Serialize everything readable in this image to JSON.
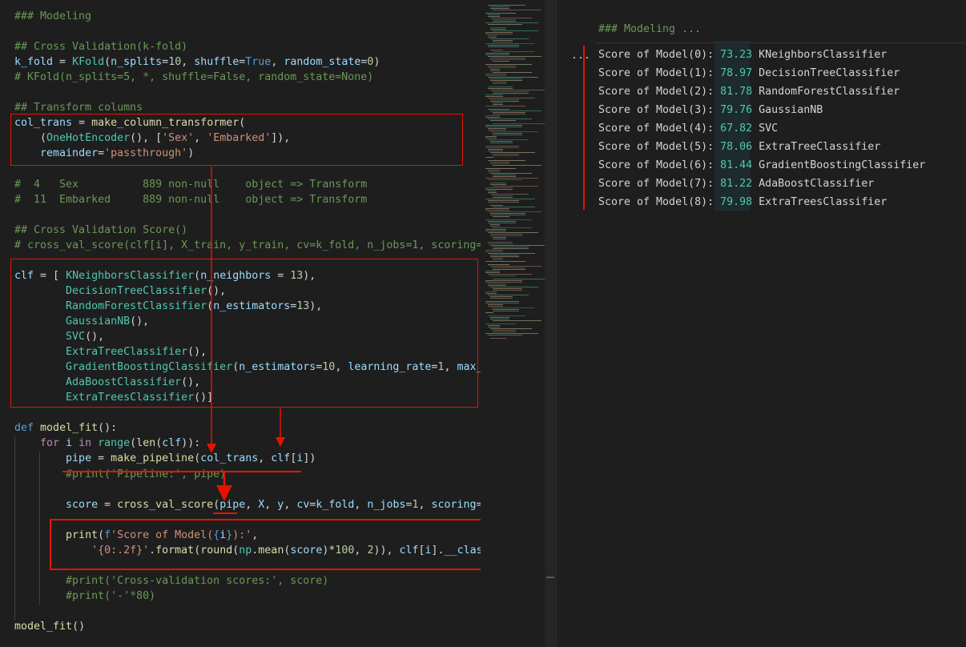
{
  "editor": {
    "lines": [
      [
        {
          "t": "### Modeling",
          "c": "comment"
        }
      ],
      [],
      [
        {
          "t": "## Cross Validation(k-fold)",
          "c": "comment"
        }
      ],
      [
        {
          "t": "k_fold",
          "c": "var"
        },
        {
          "t": " = ",
          "c": "plain"
        },
        {
          "t": "KFold",
          "c": "class"
        },
        {
          "t": "(",
          "c": "plain"
        },
        {
          "t": "n_splits",
          "c": "var"
        },
        {
          "t": "=",
          "c": "plain"
        },
        {
          "t": "10",
          "c": "num"
        },
        {
          "t": ", ",
          "c": "plain"
        },
        {
          "t": "shuffle",
          "c": "var"
        },
        {
          "t": "=",
          "c": "plain"
        },
        {
          "t": "True",
          "c": "kw"
        },
        {
          "t": ", ",
          "c": "plain"
        },
        {
          "t": "random_state",
          "c": "var"
        },
        {
          "t": "=",
          "c": "plain"
        },
        {
          "t": "0",
          "c": "num"
        },
        {
          "t": ")",
          "c": "plain"
        }
      ],
      [
        {
          "t": "# KFold(n_splits=5, *, shuffle=False, random_state=None)",
          "c": "comment"
        }
      ],
      [],
      [
        {
          "t": "## Transform columns",
          "c": "comment"
        }
      ],
      [
        {
          "t": "col_trans",
          "c": "var"
        },
        {
          "t": " = ",
          "c": "plain"
        },
        {
          "t": "make_column_transformer",
          "c": "func"
        },
        {
          "t": "(",
          "c": "plain"
        }
      ],
      [
        {
          "t": "    (",
          "c": "plain"
        },
        {
          "t": "OneHotEncoder",
          "c": "class"
        },
        {
          "t": "(), [",
          "c": "plain"
        },
        {
          "t": "'Sex'",
          "c": "str"
        },
        {
          "t": ", ",
          "c": "plain"
        },
        {
          "t": "'Embarked'",
          "c": "str"
        },
        {
          "t": "]),",
          "c": "plain"
        }
      ],
      [
        {
          "t": "    ",
          "c": "plain"
        },
        {
          "t": "remainder",
          "c": "var"
        },
        {
          "t": "=",
          "c": "plain"
        },
        {
          "t": "'passthrough'",
          "c": "str"
        },
        {
          "t": ")",
          "c": "plain"
        }
      ],
      [],
      [
        {
          "t": "#  4   Sex          889 non-null    object => Transform",
          "c": "comment"
        }
      ],
      [
        {
          "t": "#  11  Embarked     889 non-null    object => Transform",
          "c": "comment"
        }
      ],
      [],
      [
        {
          "t": "## Cross Validation Score()",
          "c": "comment"
        }
      ],
      [
        {
          "t": "# cross_val_score(clf[i], X_train, y_train, cv=k_fold, n_jobs=1, scoring=sco",
          "c": "comment"
        }
      ],
      [],
      [
        {
          "t": "clf",
          "c": "var"
        },
        {
          "t": " = [ ",
          "c": "plain"
        },
        {
          "t": "KNeighborsClassifier",
          "c": "class"
        },
        {
          "t": "(",
          "c": "plain"
        },
        {
          "t": "n_neighbors",
          "c": "var"
        },
        {
          "t": " = ",
          "c": "plain"
        },
        {
          "t": "13",
          "c": "num"
        },
        {
          "t": "),",
          "c": "plain"
        }
      ],
      [
        {
          "t": "        ",
          "c": "plain"
        },
        {
          "t": "DecisionTreeClassifier",
          "c": "class"
        },
        {
          "t": "(),",
          "c": "plain"
        }
      ],
      [
        {
          "t": "        ",
          "c": "plain"
        },
        {
          "t": "RandomForestClassifier",
          "c": "class"
        },
        {
          "t": "(",
          "c": "plain"
        },
        {
          "t": "n_estimators",
          "c": "var"
        },
        {
          "t": "=",
          "c": "plain"
        },
        {
          "t": "13",
          "c": "num"
        },
        {
          "t": "),",
          "c": "plain"
        }
      ],
      [
        {
          "t": "        ",
          "c": "plain"
        },
        {
          "t": "GaussianNB",
          "c": "class"
        },
        {
          "t": "(),",
          "c": "plain"
        }
      ],
      [
        {
          "t": "        ",
          "c": "plain"
        },
        {
          "t": "SVC",
          "c": "class"
        },
        {
          "t": "(),",
          "c": "plain"
        }
      ],
      [
        {
          "t": "        ",
          "c": "plain"
        },
        {
          "t": "ExtraTreeClassifier",
          "c": "class"
        },
        {
          "t": "(),",
          "c": "plain"
        }
      ],
      [
        {
          "t": "        ",
          "c": "plain"
        },
        {
          "t": "GradientBoostingClassifier",
          "c": "class"
        },
        {
          "t": "(",
          "c": "plain"
        },
        {
          "t": "n_estimators",
          "c": "var"
        },
        {
          "t": "=",
          "c": "plain"
        },
        {
          "t": "10",
          "c": "num"
        },
        {
          "t": ", ",
          "c": "plain"
        },
        {
          "t": "learning_rate",
          "c": "var"
        },
        {
          "t": "=",
          "c": "plain"
        },
        {
          "t": "1",
          "c": "num"
        },
        {
          "t": ", ",
          "c": "plain"
        },
        {
          "t": "max_fe",
          "c": "var"
        }
      ],
      [
        {
          "t": "        ",
          "c": "plain"
        },
        {
          "t": "AdaBoostClassifier",
          "c": "class"
        },
        {
          "t": "(),",
          "c": "plain"
        }
      ],
      [
        {
          "t": "        ",
          "c": "plain"
        },
        {
          "t": "ExtraTreesClassifier",
          "c": "class"
        },
        {
          "t": "()]",
          "c": "plain"
        }
      ],
      [],
      [
        {
          "t": "def",
          "c": "kw"
        },
        {
          "t": " ",
          "c": "plain"
        },
        {
          "t": "model_fit",
          "c": "func"
        },
        {
          "t": "():",
          "c": "plain"
        }
      ],
      [
        {
          "t": "    ",
          "c": "plain"
        },
        {
          "t": "for",
          "c": "ctrl"
        },
        {
          "t": " ",
          "c": "plain"
        },
        {
          "t": "i",
          "c": "var"
        },
        {
          "t": " ",
          "c": "plain"
        },
        {
          "t": "in",
          "c": "ctrl"
        },
        {
          "t": " ",
          "c": "plain"
        },
        {
          "t": "range",
          "c": "class"
        },
        {
          "t": "(",
          "c": "plain"
        },
        {
          "t": "len",
          "c": "func"
        },
        {
          "t": "(",
          "c": "plain"
        },
        {
          "t": "clf",
          "c": "var"
        },
        {
          "t": ")):",
          "c": "plain"
        }
      ],
      [
        {
          "t": "        ",
          "c": "plain"
        },
        {
          "t": "pipe",
          "c": "var"
        },
        {
          "t": " = ",
          "c": "plain"
        },
        {
          "t": "make_pipeline",
          "c": "func"
        },
        {
          "t": "(",
          "c": "plain"
        },
        {
          "t": "col_trans",
          "c": "var"
        },
        {
          "t": ", ",
          "c": "plain"
        },
        {
          "t": "clf",
          "c": "var"
        },
        {
          "t": "[",
          "c": "plain"
        },
        {
          "t": "i",
          "c": "var"
        },
        {
          "t": "])",
          "c": "plain"
        }
      ],
      [
        {
          "t": "        #print('Pipeline:', pipe)",
          "c": "comment"
        }
      ],
      [],
      [
        {
          "t": "        ",
          "c": "plain"
        },
        {
          "t": "score",
          "c": "var"
        },
        {
          "t": " = ",
          "c": "plain"
        },
        {
          "t": "cross_val_score",
          "c": "func"
        },
        {
          "t": "(",
          "c": "plain"
        },
        {
          "t": "pipe",
          "c": "var"
        },
        {
          "t": ", ",
          "c": "plain"
        },
        {
          "t": "X",
          "c": "var"
        },
        {
          "t": ", ",
          "c": "plain"
        },
        {
          "t": "y",
          "c": "var"
        },
        {
          "t": ", ",
          "c": "plain"
        },
        {
          "t": "cv",
          "c": "var"
        },
        {
          "t": "=",
          "c": "plain"
        },
        {
          "t": "k_fold",
          "c": "var"
        },
        {
          "t": ", ",
          "c": "plain"
        },
        {
          "t": "n_jobs",
          "c": "var"
        },
        {
          "t": "=",
          "c": "plain"
        },
        {
          "t": "1",
          "c": "num"
        },
        {
          "t": ", ",
          "c": "plain"
        },
        {
          "t": "scoring",
          "c": "var"
        },
        {
          "t": "=",
          "c": "plain"
        },
        {
          "t": "'ac",
          "c": "str"
        }
      ],
      [],
      [
        {
          "t": "        ",
          "c": "plain"
        },
        {
          "t": "print",
          "c": "func"
        },
        {
          "t": "(",
          "c": "plain"
        },
        {
          "t": "f",
          "c": "fmt"
        },
        {
          "t": "'Score of Model(",
          "c": "str"
        },
        {
          "t": "{",
          "c": "fmt"
        },
        {
          "t": "i",
          "c": "var"
        },
        {
          "t": "}",
          "c": "fmt"
        },
        {
          "t": "):'",
          "c": "str"
        },
        {
          "t": ",",
          "c": "plain"
        }
      ],
      [
        {
          "t": "            ",
          "c": "plain"
        },
        {
          "t": "'{0:.2f}'",
          "c": "str"
        },
        {
          "t": ".",
          "c": "plain"
        },
        {
          "t": "format",
          "c": "func"
        },
        {
          "t": "(",
          "c": "plain"
        },
        {
          "t": "round",
          "c": "func"
        },
        {
          "t": "(",
          "c": "plain"
        },
        {
          "t": "np",
          "c": "class"
        },
        {
          "t": ".",
          "c": "plain"
        },
        {
          "t": "mean",
          "c": "func"
        },
        {
          "t": "(",
          "c": "plain"
        },
        {
          "t": "score",
          "c": "var"
        },
        {
          "t": ")*",
          "c": "plain"
        },
        {
          "t": "100",
          "c": "num"
        },
        {
          "t": ", ",
          "c": "plain"
        },
        {
          "t": "2",
          "c": "num"
        },
        {
          "t": ")), ",
          "c": "plain"
        },
        {
          "t": "clf",
          "c": "var"
        },
        {
          "t": "[",
          "c": "plain"
        },
        {
          "t": "i",
          "c": "var"
        },
        {
          "t": "].",
          "c": "plain"
        },
        {
          "t": "__class_",
          "c": "var"
        }
      ],
      [],
      [
        {
          "t": "        #print('Cross-validation scores:', score)",
          "c": "comment"
        }
      ],
      [
        {
          "t": "        #print('-'*80)",
          "c": "comment"
        }
      ],
      [],
      [
        {
          "t": "model_fit",
          "c": "func"
        },
        {
          "t": "()",
          "c": "plain"
        }
      ]
    ]
  },
  "output": {
    "header": "### Modeling",
    "header_ellipsis": "...",
    "row_ellipsis": "...",
    "rows": [
      {
        "prefix": "Score of Model(0): ",
        "score": "73.23",
        "name": "KNeighborsClassifier"
      },
      {
        "prefix": "Score of Model(1): ",
        "score": "78.97",
        "name": "DecisionTreeClassifier"
      },
      {
        "prefix": "Score of Model(2): ",
        "score": "81.78",
        "name": "RandomForestClassifier"
      },
      {
        "prefix": "Score of Model(3): ",
        "score": "79.76",
        "name": "GaussianNB"
      },
      {
        "prefix": "Score of Model(4): ",
        "score": "67.82",
        "name": "SVC"
      },
      {
        "prefix": "Score of Model(5): ",
        "score": "78.06",
        "name": "ExtraTreeClassifier"
      },
      {
        "prefix": "Score of Model(6): ",
        "score": "81.44",
        "name": "GradientBoostingClassifier"
      },
      {
        "prefix": "Score of Model(7): ",
        "score": "81.22",
        "name": "AdaBoostClassifier"
      },
      {
        "prefix": "Score of Model(8): ",
        "score": "79.98",
        "name": "ExtraTreesClassifier"
      }
    ]
  },
  "colors": {
    "annotation_red": "#e51400",
    "background": "#1e1e1e",
    "comment": "#6a9955",
    "class": "#4ec9b0",
    "function": "#dcdcaa",
    "variable": "#9cdcfe",
    "keyword": "#569cd6",
    "string": "#ce9178",
    "number": "#b5cea8"
  }
}
